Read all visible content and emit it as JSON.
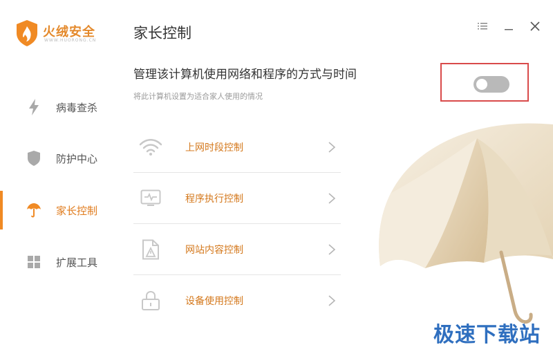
{
  "brand": {
    "title": "火绒安全",
    "subtitle": "WWW.HUORONG.CN",
    "accent": "#f08a24"
  },
  "sidebar": {
    "items": [
      {
        "label": "病毒查杀",
        "icon": "lightning-icon",
        "active": false
      },
      {
        "label": "防护中心",
        "icon": "shield-icon",
        "active": false
      },
      {
        "label": "家长控制",
        "icon": "umbrella-icon",
        "active": true
      },
      {
        "label": "扩展工具",
        "icon": "grid-icon",
        "active": false
      }
    ]
  },
  "window": {
    "controls": [
      "menu-icon",
      "minimize-icon",
      "close-icon"
    ]
  },
  "main": {
    "title": "家长控制",
    "headline": "管理该计算机使用网络和程序的方式与时间",
    "subtext": "将此计算机设置为适合家人使用的情况",
    "toggle": {
      "enabled": false,
      "highlight_color": "#d94a4a"
    },
    "features": [
      {
        "label": "上网时段控制",
        "icon": "wifi-icon"
      },
      {
        "label": "程序执行控制",
        "icon": "monitor-icon"
      },
      {
        "label": "网站内容控制",
        "icon": "document-icon"
      },
      {
        "label": "设备使用控制",
        "icon": "lock-icon"
      }
    ]
  },
  "watermark": {
    "text": "极速下载站",
    "color": "#2f6fbf"
  }
}
